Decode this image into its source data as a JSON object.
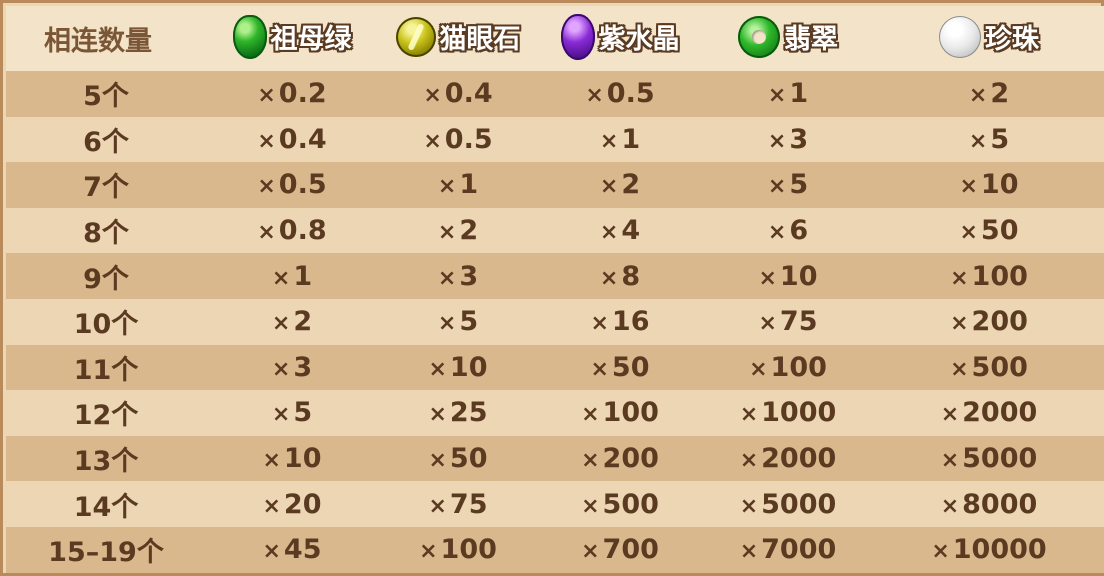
{
  "header": {
    "count_label": "相连数量",
    "gems": [
      {
        "name": "祖母绿",
        "icon": "emerald-icon"
      },
      {
        "name": "猫眼石",
        "icon": "catseye-icon"
      },
      {
        "name": "紫水晶",
        "icon": "amethyst-icon"
      },
      {
        "name": "翡翠",
        "icon": "jade-icon"
      },
      {
        "name": "珍珠",
        "icon": "pearl-icon"
      }
    ]
  },
  "multiplier_symbol": "×",
  "rows": [
    {
      "count": "5个",
      "values": [
        "0.2",
        "0.4",
        "0.5",
        "1",
        "2"
      ]
    },
    {
      "count": "6个",
      "values": [
        "0.4",
        "0.5",
        "1",
        "3",
        "5"
      ]
    },
    {
      "count": "7个",
      "values": [
        "0.5",
        "1",
        "2",
        "5",
        "10"
      ]
    },
    {
      "count": "8个",
      "values": [
        "0.8",
        "2",
        "4",
        "6",
        "50"
      ]
    },
    {
      "count": "9个",
      "values": [
        "1",
        "3",
        "8",
        "10",
        "100"
      ]
    },
    {
      "count": "10个",
      "values": [
        "2",
        "5",
        "16",
        "75",
        "200"
      ]
    },
    {
      "count": "11个",
      "values": [
        "3",
        "10",
        "50",
        "100",
        "500"
      ]
    },
    {
      "count": "12个",
      "values": [
        "5",
        "25",
        "100",
        "1000",
        "2000"
      ]
    },
    {
      "count": "13个",
      "values": [
        "10",
        "50",
        "200",
        "2000",
        "5000"
      ]
    },
    {
      "count": "14个",
      "values": [
        "20",
        "75",
        "500",
        "5000",
        "8000"
      ]
    },
    {
      "count": "15–19个",
      "values": [
        "45",
        "100",
        "700",
        "7000",
        "10000"
      ]
    }
  ],
  "colors": {
    "header_bg": "#f3e4c9",
    "row_dark": "#d8b88c",
    "row_light": "#ecd6b4",
    "text": "#5b3a22",
    "border": "#b98a5a"
  }
}
